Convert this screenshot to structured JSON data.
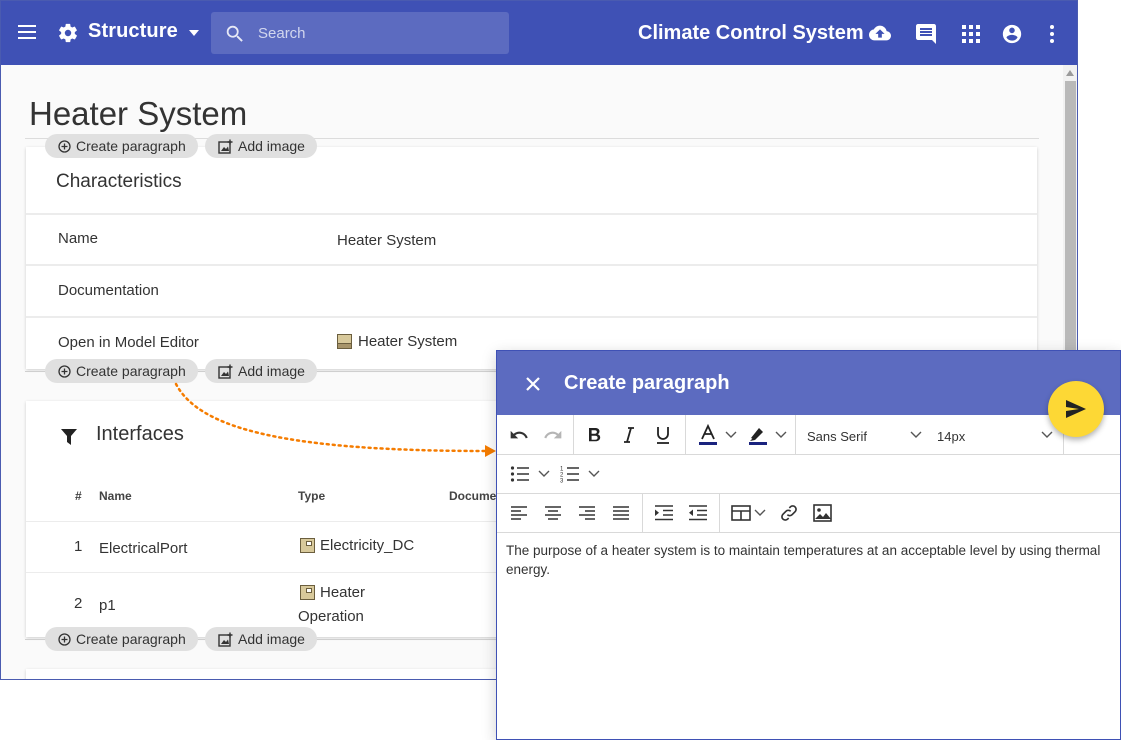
{
  "appbar": {
    "app_name": "Structure",
    "search_placeholder": "Search",
    "project_name": "Climate Control System"
  },
  "page": {
    "title": "Heater System"
  },
  "actions": {
    "create_paragraph": "Create paragraph",
    "add_image": "Add image"
  },
  "characteristics": {
    "title": "Characteristics",
    "rows": [
      {
        "label": "Name",
        "value": "Heater System"
      },
      {
        "label": "Documentation",
        "value": ""
      },
      {
        "label": "Open in Model Editor",
        "value": "Heater System"
      }
    ]
  },
  "interfaces": {
    "title": "Interfaces",
    "columns": [
      "#",
      "Name",
      "Type",
      "Documen"
    ],
    "rows": [
      {
        "index": "1",
        "name": "ElectricalPort",
        "type_lines": [
          "Electricity_DC"
        ]
      },
      {
        "index": "2",
        "name": "p1",
        "type_lines": [
          "Heater",
          "Operation"
        ]
      }
    ]
  },
  "dialog": {
    "title": "Create paragraph",
    "font_family": "Sans Serif",
    "font_size": "14px",
    "body_text": "The purpose of a heater system is to maintain temperatures at an acceptable level by using thermal energy."
  },
  "colors": {
    "appbar": "#3f51b5",
    "dialog_header": "#5c6bc0",
    "fab": "#fdd835",
    "connector": "#f57c00"
  }
}
